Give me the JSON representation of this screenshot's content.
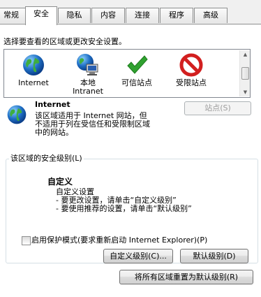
{
  "tabs": [
    {
      "label": "常规",
      "active": false
    },
    {
      "label": "安全",
      "active": true
    },
    {
      "label": "隐私",
      "active": false
    },
    {
      "label": "内容",
      "active": false
    },
    {
      "label": "连接",
      "active": false
    },
    {
      "label": "程序",
      "active": false
    },
    {
      "label": "高级",
      "active": false
    }
  ],
  "instruction": "选择要查看的区域或更改安全设置。",
  "zones": [
    {
      "label": "Internet",
      "icon": "globe-icon"
    },
    {
      "label": "本地\nIntranet",
      "icon": "intranet-icon"
    },
    {
      "label": "可信站点",
      "icon": "checkmark-icon"
    },
    {
      "label": "受限站点",
      "icon": "no-entry-icon"
    }
  ],
  "selected_zone": {
    "title": "Internet",
    "description": "该区域适用于 Internet 网站，但\n不适用于列在受信任和受限制区域\n中的网站。",
    "sites_button": "站点(S)",
    "sites_button_enabled": false
  },
  "security_level": {
    "group_label": "该区域的安全级别(L)",
    "level_title": "自定义",
    "level_subtitle": "自定义设置",
    "bullet1": "- 要更改设置，请单击“自定义级别”",
    "bullet2": "- 要使用推荐的设置，请单击“默认级别”"
  },
  "protected_mode": {
    "label": "启用保护模式(要求重新启动 Internet Explorer)(P)",
    "checked": false
  },
  "buttons": {
    "custom_level": "自定义级别(C)...",
    "default_level": "默认级别(D)",
    "reset_all": "将所有区域重置为默认级别(R)"
  },
  "colors": {
    "accent_green": "#2fa12f",
    "restricted_red": "#d21f1f",
    "globe_blue": "#1f6fc5",
    "border": "#8e8f8f"
  }
}
